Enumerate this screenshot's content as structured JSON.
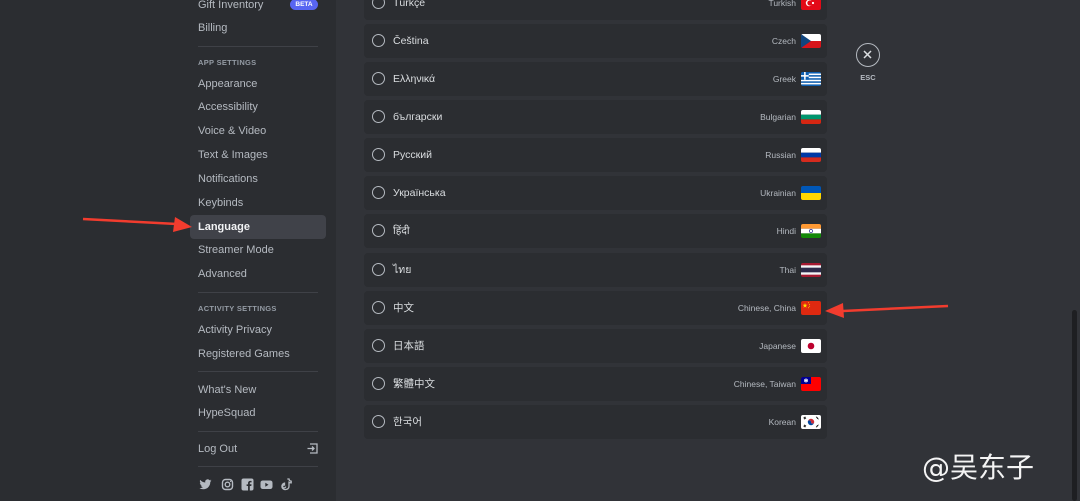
{
  "sidebar": {
    "items_top": [
      {
        "label": "Gift Inventory",
        "badge": "BETA"
      },
      {
        "label": "Billing"
      }
    ],
    "app_settings_header": "APP SETTINGS",
    "app_settings": [
      "Appearance",
      "Accessibility",
      "Voice & Video",
      "Text & Images",
      "Notifications",
      "Keybinds",
      "Language",
      "Streamer Mode",
      "Advanced"
    ],
    "active_item": "Language",
    "activity_settings_header": "ACTIVITY SETTINGS",
    "activity_settings": [
      "Activity Privacy",
      "Registered Games"
    ],
    "misc": [
      "What's New",
      "HypeSquad"
    ],
    "logout_label": "Log Out",
    "social_icons": [
      "twitter-icon",
      "instagram-icon",
      "facebook-icon",
      "youtube-icon",
      "tiktok-icon"
    ]
  },
  "languages": [
    {
      "native": "Türkçe",
      "english": "Turkish",
      "flag": "turkey"
    },
    {
      "native": "Čeština",
      "english": "Czech",
      "flag": "czech"
    },
    {
      "native": "Ελληνικά",
      "english": "Greek",
      "flag": "greece"
    },
    {
      "native": "български",
      "english": "Bulgarian",
      "flag": "bulgaria"
    },
    {
      "native": "Русский",
      "english": "Russian",
      "flag": "russia"
    },
    {
      "native": "Українська",
      "english": "Ukrainian",
      "flag": "ukraine"
    },
    {
      "native": "हिंदी",
      "english": "Hindi",
      "flag": "india"
    },
    {
      "native": "ไทย",
      "english": "Thai",
      "flag": "thailand"
    },
    {
      "native": "中文",
      "english": "Chinese, China",
      "flag": "china"
    },
    {
      "native": "日本語",
      "english": "Japanese",
      "flag": "japan"
    },
    {
      "native": "繁體中文",
      "english": "Chinese, Taiwan",
      "flag": "taiwan"
    },
    {
      "native": "한국어",
      "english": "Korean",
      "flag": "korea"
    }
  ],
  "close": {
    "label": "ESC"
  },
  "watermark": "@吴东子",
  "colors": {
    "accent": "#5865f2",
    "arrow": "#f23c2e"
  }
}
